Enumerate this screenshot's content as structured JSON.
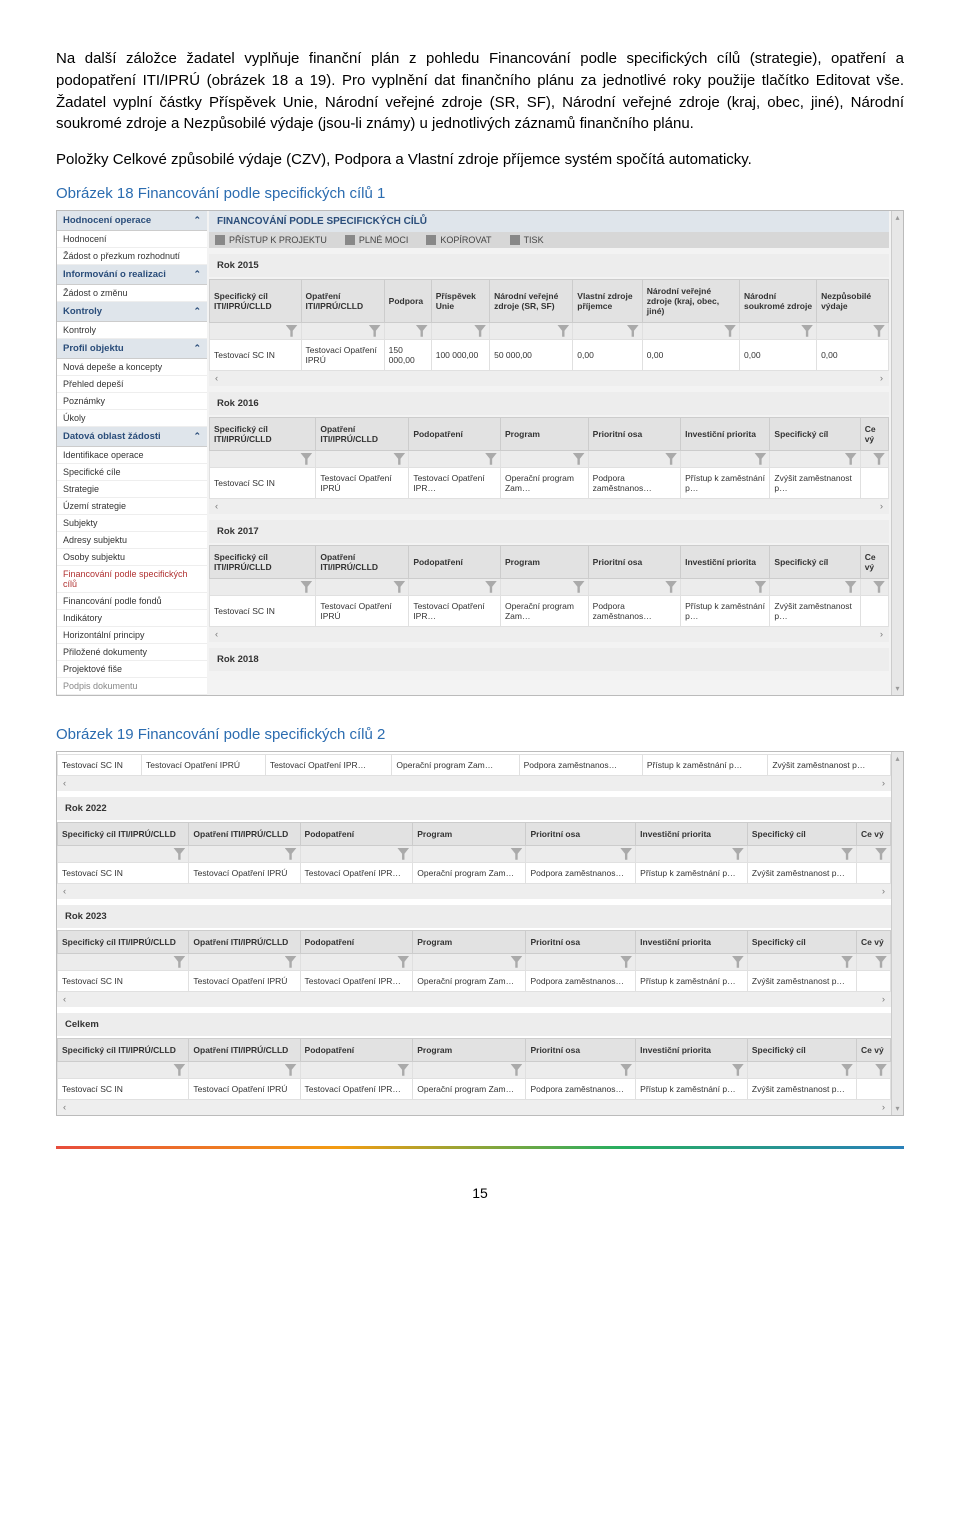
{
  "paragraphs": {
    "p1": "Na další záložce žadatel vyplňuje finanční plán z pohledu Financování podle specifických cílů (strategie), opatření a podopatření ITI/IPRÚ (obrázek 18 a 19). Pro vyplnění dat finančního plánu za jednotlivé roky použije tlačítko Editovat vše. Žadatel vyplní částky Příspěvek Unie, Národní veřejné zdroje (SR, SF), Národní veřejné zdroje (kraj, obec, jiné), Národní soukromé zdroje a Nezpůsobilé výdaje (jsou-li známy) u jednotlivých záznamů finančního plánu.",
    "p2": "Položky Celkové způsobilé výdaje (CZV), Podpora a Vlastní zdroje příjemce systém spočítá automaticky.",
    "cap1": "Obrázek 18 Financování podle specifických cílů 1",
    "cap2": "Obrázek 19 Financování podle specifických cílů 2"
  },
  "sidebar": {
    "groups": [
      {
        "header": "Hodnocení operace",
        "items": [
          "Hodnocení",
          "Žádost o přezkum rozhodnutí"
        ]
      },
      {
        "header": "Informování o realizaci",
        "items": [
          "Žádost o změnu"
        ]
      },
      {
        "header": "Kontroly",
        "items": [
          "Kontroly"
        ]
      },
      {
        "header": "Profil objektu",
        "items": [
          "Nová depeše a koncepty",
          "Přehled depeší",
          "Poznámky",
          "Úkoly"
        ]
      },
      {
        "header": "Datová oblast žádosti",
        "items": [
          "Identifikace operace",
          "Specifické cíle",
          "Strategie",
          "Území strategie",
          "Subjekty",
          "Adresy subjektu",
          "Osoby subjektu",
          "Financování podle specifických cílů",
          "Financování podle fondů",
          "Indikátory",
          "Horizontální principy",
          "Přiložené dokumenty",
          "Projektové fiše",
          "Podpis dokumentu"
        ],
        "activeIndex": 7,
        "dimIndex": 13
      }
    ]
  },
  "main": {
    "title": "FINANCOVÁNÍ PODLE SPECIFICKÝCH CÍLŮ",
    "toolbar": [
      "PŘÍSTUP K PROJEKTU",
      "PLNÉ MOCI",
      "KOPÍROVAT",
      "TISK"
    ]
  },
  "year2015": {
    "label": "Rok 2015",
    "headers": [
      "Specifický cíl ITI/IPRÚ/CLLD",
      "Opatření ITI/IPRÚ/CLLD",
      "Podpora",
      "Příspěvek Unie",
      "Národní veřejné zdroje (SR, SF)",
      "Vlastní zdroje příjemce",
      "Národní veřejné zdroje (kraj, obec, jiné)",
      "Národní soukromé zdroje",
      "Nezpůsobilé výdaje"
    ],
    "row": [
      "Testovací SC IN",
      "Testovací Opatření IPRÚ",
      "150 000,00",
      "100 000,00",
      "50 000,00",
      "0,00",
      "0,00",
      "0,00",
      "0,00"
    ]
  },
  "yearsDetail": {
    "headers": [
      "Specifický cíl ITI/IPRÚ/CLLD",
      "Opatření ITI/IPRÚ/CLLD",
      "Podopatření",
      "Program",
      "Prioritní osa",
      "Investiční priorita",
      "Specifický cíl",
      "Ce vý"
    ],
    "row": [
      "Testovací SC IN",
      "Testovací Opatření IPRÚ",
      "Testovací Opatření IPR…",
      "Operační program Zam…",
      "Podpora zaměstnanos…",
      "Přístup k zaměstnání p…",
      "Zvýšit zaměstnanost p…",
      ""
    ],
    "years1": [
      "Rok 2016",
      "Rok 2017",
      "Rok 2018"
    ],
    "years2": [
      "Rok 2022",
      "Rok 2023",
      "Celkem"
    ]
  },
  "topRow2": [
    "Testovací SC IN",
    "Testovací Opatření IPRÚ",
    "Testovací Opatření IPR…",
    "Operační program Zam…",
    "Podpora zaměstnanos…",
    "Přístup k zaměstnání p…",
    "Zvýšit zaměstnanost p…"
  ],
  "pageNumber": "15"
}
